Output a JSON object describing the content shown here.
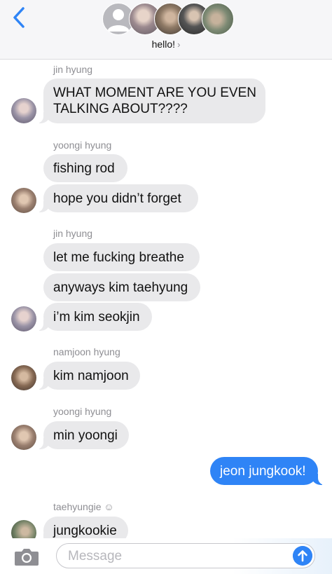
{
  "header": {
    "title": "hello!",
    "chevron": "›",
    "back_icon": "chevron-left-icon"
  },
  "messages": [
    {
      "sender": "jin hyung",
      "text": "WHAT MOMENT ARE YOU EVEN",
      "text2": "TALKING ABOUT????"
    },
    {
      "sender": "yoongi hyung",
      "texts": [
        "fishing rod",
        "hope you didn’t forget"
      ]
    },
    {
      "sender": "jin hyung",
      "texts": [
        "let me fucking breathe",
        "anyways kim taehyung",
        "i’m kim seokjin"
      ]
    },
    {
      "sender": "namjoon hyung",
      "texts": [
        "kim namjoon"
      ]
    },
    {
      "sender": "yoongi hyung",
      "texts": [
        "min yoongi"
      ]
    },
    {
      "sent_text": "jeon jungkook!"
    },
    {
      "sender": "taehyungie ☺",
      "texts": [
        "jungkookie"
      ]
    }
  ],
  "compose": {
    "placeholder": "Message",
    "camera_icon": "camera-icon",
    "send_icon": "arrow-up-icon"
  },
  "colors": {
    "incoming": "#e9e9eb",
    "outgoing": "#2f84f6",
    "header_bg": "#f6f6f8",
    "back_tint": "#2f84f6"
  }
}
